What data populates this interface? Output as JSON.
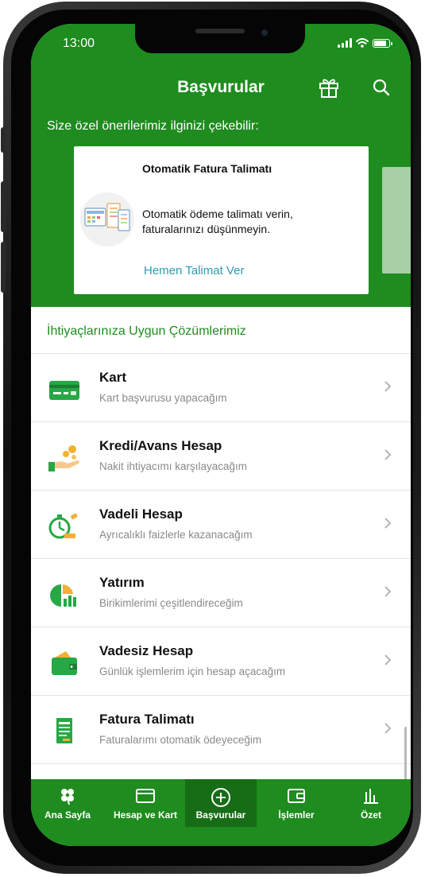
{
  "status_bar": {
    "time": "13:00"
  },
  "header": {
    "title": "Başvurular",
    "gift_icon": "gift-icon",
    "search_icon": "search-icon"
  },
  "promo": {
    "heading": "Size özel önerilerimiz ilginizi çekebilir:",
    "card": {
      "title": "Otomatik Fatura Talimatı",
      "text": "Otomatik ödeme talimatı verin, faturalarınızı düşünmeyin.",
      "cta": "Hemen Talimat Ver"
    }
  },
  "solutions": {
    "title": "İhtiyaçlarınıza Uygun Çözümlerimiz",
    "items": [
      {
        "title": "Kart",
        "subtitle": "Kart başvurusu yapacağım",
        "icon": "card-icon"
      },
      {
        "title": "Kredi/Avans Hesap",
        "subtitle": "Nakit ihtiyacımı karşılayacağım",
        "icon": "loan-icon"
      },
      {
        "title": "Vadeli Hesap",
        "subtitle": "Ayrıcalıklı faizlerle kazanacağım",
        "icon": "deposit-icon"
      },
      {
        "title": "Yatırım",
        "subtitle": "Birikimlerimi çeşitlendireceğim",
        "icon": "investment-icon"
      },
      {
        "title": "Vadesiz Hesap",
        "subtitle": "Günlük işlemlerim için hesap açacağım",
        "icon": "wallet-icon"
      },
      {
        "title": "Fatura Talimatı",
        "subtitle": "Faturalarımı otomatik ödeyeceğim",
        "icon": "bill-icon"
      }
    ]
  },
  "tabbar": {
    "active": "Başvurular",
    "items": [
      {
        "label": "Ana Sayfa",
        "icon": "clover-icon"
      },
      {
        "label": "Hesap ve Kart",
        "icon": "card-icon"
      },
      {
        "label": "Başvurular",
        "icon": "plus-circle-icon"
      },
      {
        "label": "İşlemler",
        "icon": "wallet-icon"
      },
      {
        "label": "Özet",
        "icon": "bar-chart-icon"
      }
    ]
  },
  "colors": {
    "brand_green": "#1e8c1e",
    "link": "#2f9bb0",
    "section_title": "#1e8c1e"
  }
}
